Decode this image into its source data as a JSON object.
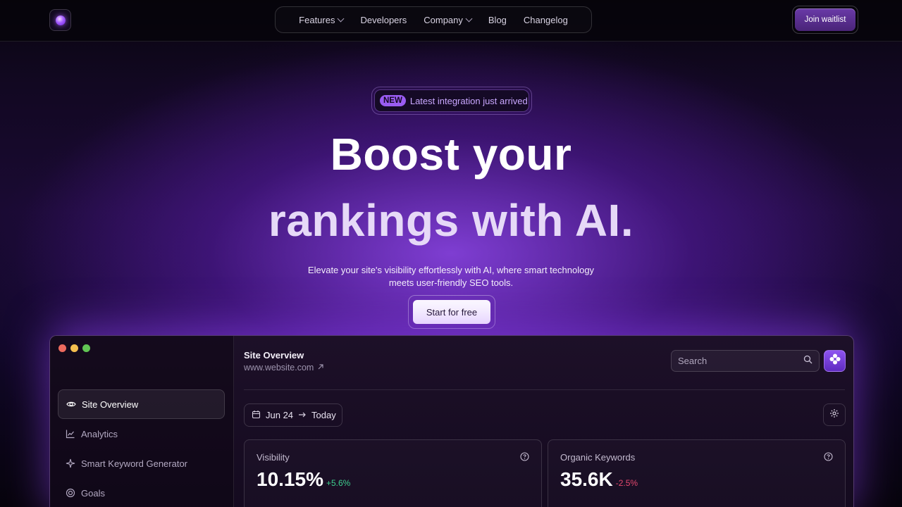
{
  "header": {
    "nav": [
      {
        "label": "Features",
        "has_dropdown": true
      },
      {
        "label": "Developers",
        "has_dropdown": false
      },
      {
        "label": "Company",
        "has_dropdown": true
      },
      {
        "label": "Blog",
        "has_dropdown": false
      },
      {
        "label": "Changelog",
        "has_dropdown": false
      }
    ],
    "join_label": "Join waitlist"
  },
  "hero": {
    "badge_new": "NEW",
    "badge_text": "Latest integration just arrived",
    "title_line1": "Boost your",
    "title_line2": "rankings with AI.",
    "subtitle": "Elevate your site's visibility effortlessly with AI, where smart technology meets user-friendly SEO tools.",
    "cta_label": "Start for free"
  },
  "app": {
    "window_dot_colors": [
      "#ed6a5e",
      "#f5bf4f",
      "#61c554"
    ],
    "sidebar": [
      {
        "label": "Site Overview",
        "icon": "eye-icon",
        "active": true
      },
      {
        "label": "Analytics",
        "icon": "line-chart-icon",
        "active": false
      },
      {
        "label": "Smart Keyword Generator",
        "icon": "sparkle-icon",
        "active": false
      },
      {
        "label": "Goals",
        "icon": "target-icon",
        "active": false
      }
    ],
    "title": "Site Overview",
    "url": "www.website.com",
    "search_placeholder": "Search",
    "date_from": "Jun 24",
    "date_to": "Today",
    "cards": [
      {
        "label": "Visibility",
        "value": "10.15%",
        "delta": "+5.6%",
        "delta_color": "#3ecf8e"
      },
      {
        "label": "Organic Keywords",
        "value": "35.6K",
        "delta": "-2.5%",
        "delta_color": "#e5486e"
      }
    ]
  },
  "colors": {
    "accent": "#9a5cf2",
    "background": "#07040c"
  }
}
